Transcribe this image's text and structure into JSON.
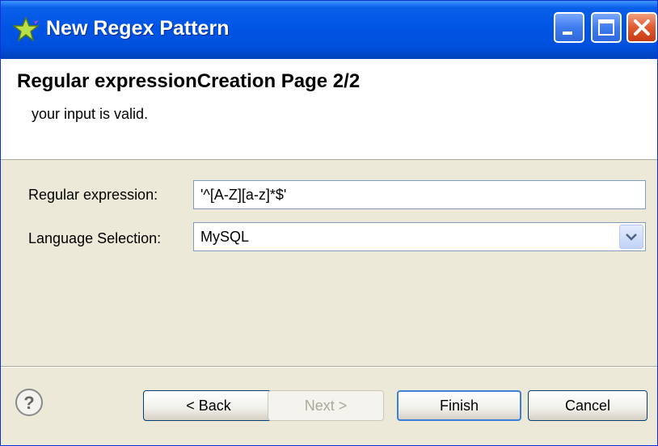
{
  "window": {
    "title": "New Regex Pattern"
  },
  "header": {
    "page_title": "Regular expressionCreation Page 2/2",
    "message": "your input is valid."
  },
  "form": {
    "regex_label": "Regular expression:",
    "regex_value": "'^[A-Z][a-z]*$'",
    "language_label": "Language Selection:",
    "language_value": "MySQL"
  },
  "buttons": {
    "back": "< Back",
    "next": "Next >",
    "finish": "Finish",
    "cancel": "Cancel"
  },
  "colors": {
    "titlebar": "#0055e5",
    "dialog_bg": "#ece9d8",
    "header_bg": "#ffffff"
  },
  "icons": {
    "app": "star-icon",
    "help": "help-icon",
    "dropdown": "chevron-down-icon"
  }
}
